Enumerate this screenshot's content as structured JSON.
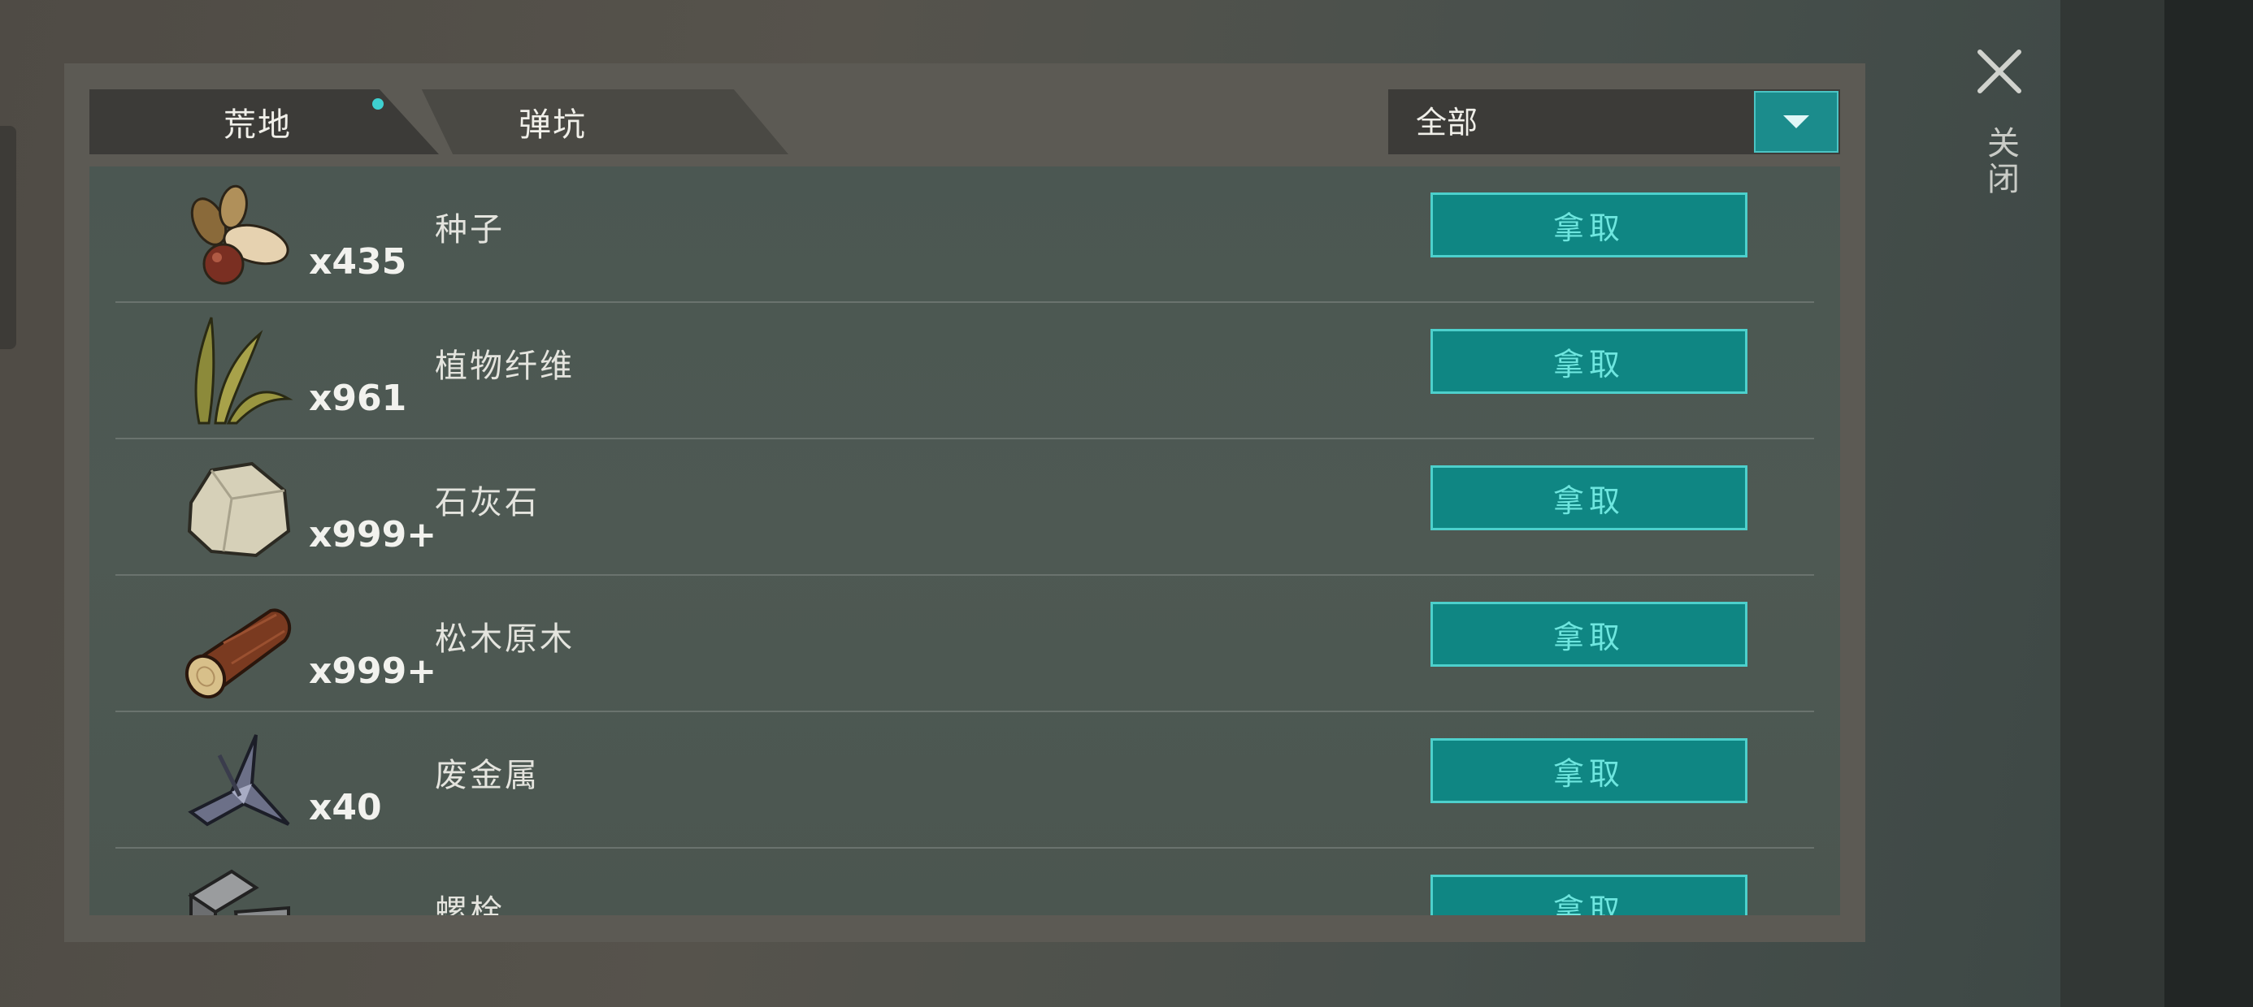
{
  "tabs": [
    {
      "label": "荒地",
      "active": true,
      "has_dot": true
    },
    {
      "label": "弹坑",
      "active": false
    }
  ],
  "filter": {
    "selected": "全部"
  },
  "close": {
    "label": "关闭"
  },
  "take_label": "拿取",
  "items": [
    {
      "icon": "seeds-icon",
      "name": "种子",
      "count": "x435"
    },
    {
      "icon": "plant-fiber-icon",
      "name": "植物纤维",
      "count": "x961"
    },
    {
      "icon": "limestone-icon",
      "name": "石灰石",
      "count": "x999+"
    },
    {
      "icon": "pine-log-icon",
      "name": "松木原木",
      "count": "x999+"
    },
    {
      "icon": "scrap-metal-icon",
      "name": "废金属",
      "count": "x40"
    },
    {
      "icon": "bolt-icon",
      "name": "螺栓",
      "count": ""
    }
  ],
  "colors": {
    "accent": "#0f8683",
    "accent_border": "#4dd0cc",
    "accent_text": "#6ee6df",
    "tab_dot": "#3ed0d0"
  }
}
